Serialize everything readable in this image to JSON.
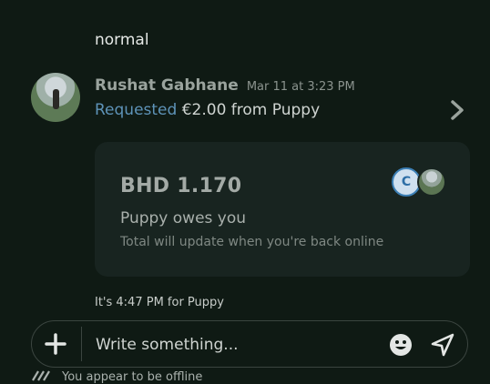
{
  "previous_message": {
    "text": "normal"
  },
  "message": {
    "sender": "Rushat Gabhane",
    "timestamp": "Mar 11 at 3:23 PM",
    "status_word": "Requested",
    "amount": "€2.00",
    "rest": "from Puppy"
  },
  "request_card": {
    "amount": "BHD 1.170",
    "status": "Puppy owes you",
    "note": "Total will update when you're back online",
    "avatar_initial": "C"
  },
  "local_time": {
    "text": "It's 4:47 PM for Puppy"
  },
  "composer": {
    "placeholder": "Write something..."
  },
  "offline_banner": {
    "text": "You appear to be offline"
  },
  "colors": {
    "background": "#0f1a14",
    "card": "#182420",
    "link": "#5e93b8"
  },
  "icons": [
    "chevron-right-icon",
    "plus-icon",
    "emoji-icon",
    "send-icon",
    "offline-icon"
  ]
}
